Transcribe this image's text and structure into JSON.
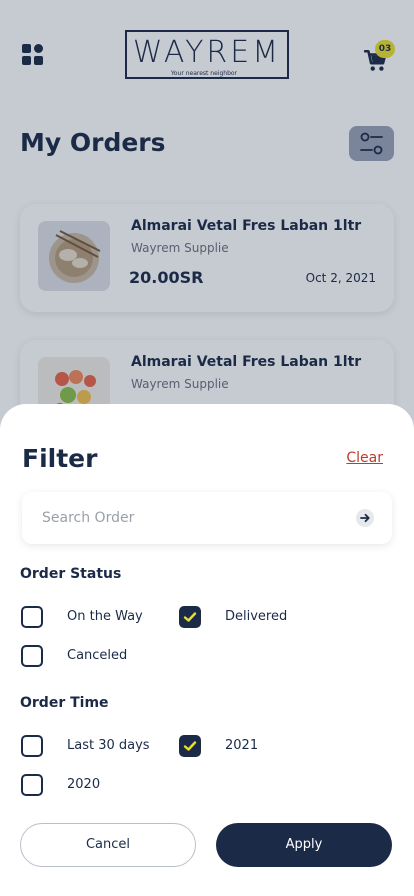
{
  "header": {
    "logo_text": "WAYREM",
    "logo_tagline": "Your nearest neighbor",
    "cart_count": "03"
  },
  "page": {
    "title": "My Orders"
  },
  "orders": [
    {
      "name": "Almarai Vetal Fres Laban 1ltr",
      "supplier": "Wayrem Supplie",
      "price": "20.00SR",
      "date": "Oct 2, 2021"
    },
    {
      "name": "Almarai Vetal Fres Laban 1ltr",
      "supplier": "Wayrem Supplie"
    }
  ],
  "filter": {
    "title": "Filter",
    "clear_label": "Clear",
    "search_placeholder": "Search Order",
    "order_status": {
      "label": "Order Status",
      "options": [
        {
          "label": "On the Way",
          "checked": false
        },
        {
          "label": "Delivered",
          "checked": true
        },
        {
          "label": "Canceled",
          "checked": false
        }
      ]
    },
    "order_time": {
      "label": "Order Time",
      "options": [
        {
          "label": "Last 30 days",
          "checked": false
        },
        {
          "label": "2021",
          "checked": true
        },
        {
          "label": "2020",
          "checked": false
        }
      ]
    },
    "cancel_label": "Cancel",
    "apply_label": "Apply"
  },
  "colors": {
    "primary": "#1b2b47",
    "accent_badge": "#e8e02a",
    "clear_link": "#c0392b",
    "check": "#e8e02a"
  }
}
